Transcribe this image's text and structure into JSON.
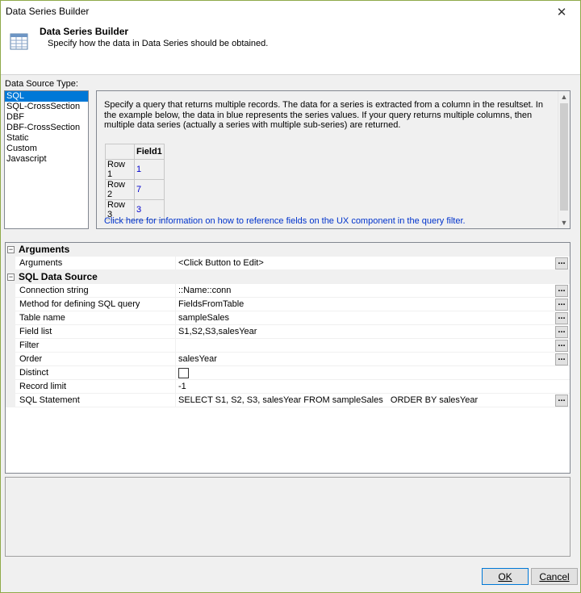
{
  "window": {
    "title": "Data Series Builder",
    "close_glyph": "✕"
  },
  "header": {
    "title": "Data Series Builder",
    "subtitle": "Specify how the data in Data Series should be obtained.",
    "icon": "table-grid-icon"
  },
  "data_source": {
    "label": "Data Source Type:",
    "items": [
      "SQL",
      "SQL-CrossSection",
      "DBF",
      "DBF-CrossSection",
      "Static",
      "Custom",
      "Javascript"
    ],
    "selected": "SQL"
  },
  "description": {
    "text": "Specify a query that returns multiple records. The data for a series is extracted from a column in the resultset. In the example below, the data in blue represents the series values. If your query returns multiple columns, then multiple data series (actually a series with multiple sub-series) are returned.",
    "table": {
      "header": "Field1",
      "rows": [
        {
          "label": "Row 1",
          "value": "1"
        },
        {
          "label": "Row 2",
          "value": "7"
        },
        {
          "label": "Row 3",
          "value": "3"
        }
      ]
    },
    "link": "Click here for information on how to reference fields on the UX component in the query filter."
  },
  "properties": {
    "cat_arguments": "Arguments",
    "arguments_name": "Arguments",
    "arguments_value": "<Click Button to Edit>",
    "cat_sql": "SQL Data Source",
    "connection_name": "Connection string",
    "connection_value": "::Name::conn",
    "method_name": "Method for defining SQL query",
    "method_value": "FieldsFromTable",
    "table_name": "Table name",
    "table_value": "sampleSales",
    "fieldlist_name": "Field list",
    "fieldlist_value": "S1,S2,S3,salesYear",
    "filter_name": "Filter",
    "filter_value": "",
    "order_name": "Order",
    "order_value": "salesYear",
    "distinct_name": "Distinct",
    "distinct_checked": false,
    "limit_name": "Record limit",
    "limit_value": "-1",
    "sql_name": "SQL Statement",
    "sql_value": "SELECT S1, S2, S3, salesYear FROM sampleSales   ORDER BY salesYear",
    "ellipsis": "..."
  },
  "buttons": {
    "ok": "OK",
    "cancel": "Cancel"
  }
}
